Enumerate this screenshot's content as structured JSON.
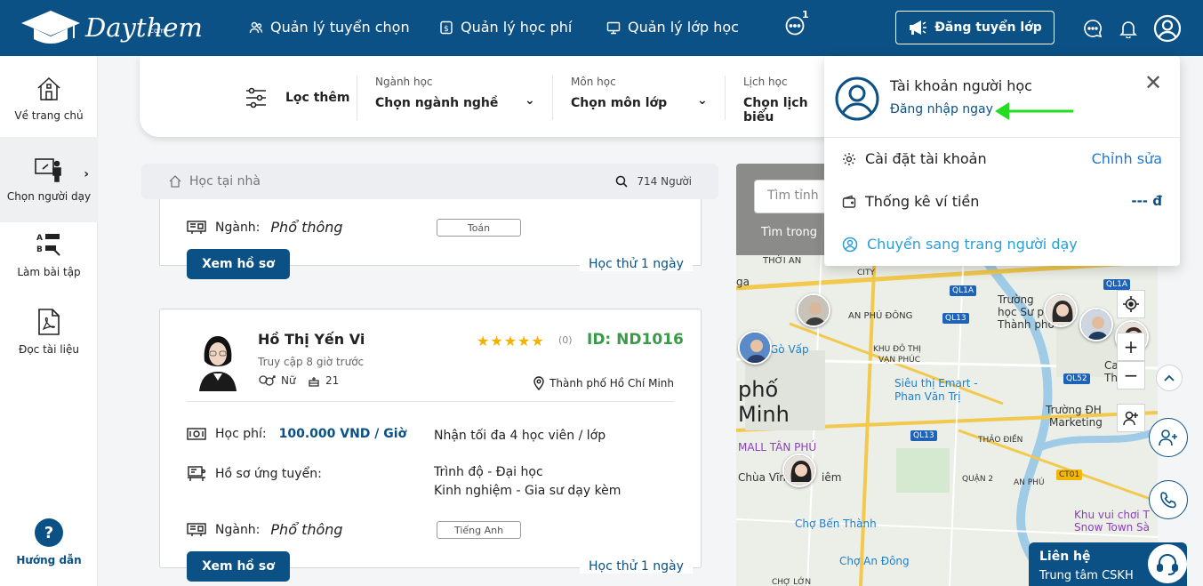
{
  "brand": {
    "name": "Daythem",
    "suffix": ".com"
  },
  "nav": {
    "items": [
      {
        "label": "Quản lý tuyển chọn"
      },
      {
        "label": "Quản lý học phí"
      },
      {
        "label": "Quản lý lớp học"
      }
    ],
    "message_badge": "1",
    "post_button": "Đăng tuyển lớp"
  },
  "sidebar": {
    "items": [
      {
        "label": "Về trang chủ"
      },
      {
        "label": "Chọn người dạy"
      },
      {
        "label": "Làm bài tập"
      },
      {
        "label": "Đọc tài liệu"
      }
    ],
    "help": "Hướng dẫn"
  },
  "filter": {
    "more_label": "Lọc thêm",
    "groups": [
      {
        "caption": "Ngành học",
        "value": "Chọn ngành nghề"
      },
      {
        "caption": "Môn học",
        "value": "Chọn môn lớp"
      },
      {
        "caption": "Lịch học",
        "value": "Chọn lịch biểu"
      }
    ]
  },
  "list": {
    "search_placeholder": "Học tại nhà",
    "count": "714 Người"
  },
  "card_prev": {
    "field_label": "Ngành:",
    "field_value": "Phổ thông",
    "tag": "Toán",
    "button": "Xem hồ sơ",
    "trial": "Học thử 1 ngày"
  },
  "card": {
    "name": "Hồ Thị Yến Vi",
    "access": "Truy cập 8 giờ trước",
    "gender": "Nữ",
    "age": "21",
    "rating_stars": 5,
    "review_count": "(0)",
    "id": "ID: ND1016",
    "location": "Thành phố Hồ Chí Minh",
    "fee_label": "Học phí:",
    "fee_value": "100.000 VND / Giờ",
    "capacity": "Nhận tối đa 4 học viên / lớp",
    "profile_label": "Hồ sơ ứng tuyển:",
    "degree": "Trình độ - Đại học",
    "experience": "Kinh nghiệm - Gia sư dạy kèm",
    "field_label": "Ngành:",
    "field_value": "Phổ thông",
    "tag": "Tiếng Anh",
    "button": "Xem hồ sơ",
    "trial": "Học thử 1 ngày"
  },
  "map": {
    "search_placeholder": "Tìm tỉnh",
    "overlay_text": "Tìm trong",
    "labels": {
      "thoi_an": "THỚI AN",
      "an_phu_dong": "AN PHÚ ĐÔNG",
      "go_vap": "Gò Vấp",
      "khu_do_thi": "KHU ĐÔ THỊ",
      "van_phuc": "VẠN PHÚC",
      "city_name_1": "phố",
      "city_name_2": "Minh",
      "emart_1": "Siêu thị Emart -",
      "emart_2": "Phan Văn Trị",
      "tan_phu": "MALL TÂN PHÚ",
      "chua_vinh": "Chùa Vĩnh",
      "nghiem": "iêm",
      "cho_ben_thanh": "Chợ Bến Thành",
      "cho_an_dong": "Chợ An Đông",
      "cho_lon": "CHỢ LỚN",
      "quan_2": "QUẬN 2",
      "an_phu": "AN PHÚ",
      "thao_dien": "THẢO ĐIỀN",
      "truong_1": "Trường ĐH",
      "truong_2": "Marketing",
      "khu_vui_choi_1": "Khu vui chơi T",
      "khu_vui_choi_2": "Snow Town Sà",
      "truong_top_1": "Trường",
      "truong_top_2": "học Sư p",
      "truong_top_3": "Thành phố",
      "ca": "Ca",
      "th": "Th",
      "ga": "ga",
      "city": "CITY",
      "ql1a_top": "QL1A",
      "ql1a": "QL1A",
      "ql13_1": "QL13",
      "ql13_2": "QL13",
      "ql52": "QL52",
      "ct01": "CT01"
    },
    "zoom_in": "+",
    "zoom_out": "−"
  },
  "account_panel": {
    "title": "Tài khoản người học",
    "login": "Đăng nhập ngay",
    "rows": [
      {
        "label": "Cài đặt tài khoản",
        "action": "Chỉnh sửa"
      },
      {
        "label": "Thống kê ví tiền",
        "action": "--- đ"
      }
    ],
    "switch": "Chuyển sang trang người dạy"
  },
  "contact": {
    "title": "Liên hệ",
    "subtitle": "Trung tâm CSKH"
  },
  "colors": {
    "brand": "#0b5185",
    "accent_green": "#3a9a4a",
    "star": "#f6b100",
    "arrow": "#22dd22"
  }
}
